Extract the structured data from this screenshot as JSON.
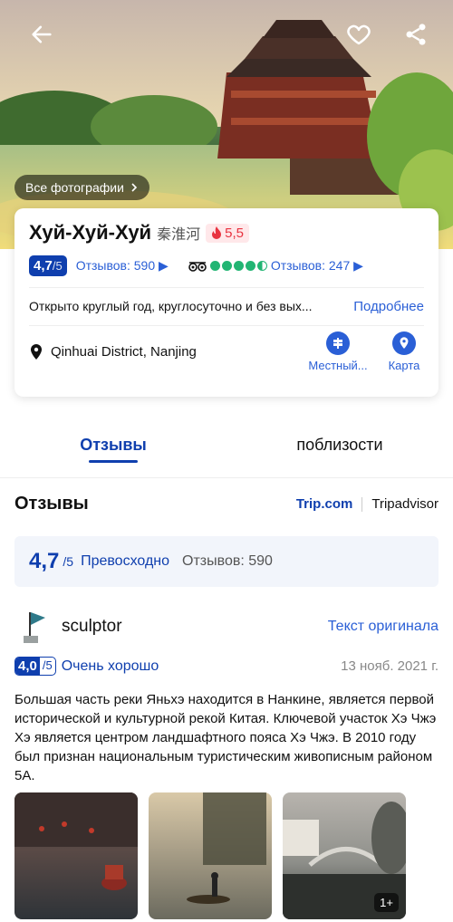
{
  "hero": {
    "all_photos_label": "Все фотографии"
  },
  "attraction": {
    "name": "Хуй-Хуй-Хуй",
    "name_cn": "秦淮河",
    "hot_score": "5,5",
    "trip_score": "4,7",
    "trip_score_max": "/5",
    "trip_reviews": "Отзывов: 590",
    "ta_reviews": "Отзывов: 247",
    "ta_bubbles": 4.5,
    "hours": "Открыто круглый год, круглосуточно и без вых...",
    "more_label": "Подробнее",
    "location": "Qinhuai District, Nanjing",
    "actions": [
      {
        "label": "Местный..."
      },
      {
        "label": "Карта"
      }
    ]
  },
  "tabs": [
    {
      "label": "Отзывы"
    },
    {
      "label": "поблизости"
    }
  ],
  "reviews": {
    "heading": "Отзывы",
    "sources": [
      "Trip.com",
      "Tripadvisor"
    ],
    "summary_score": "4,7",
    "summary_max": "/5",
    "summary_label": "Превосходно",
    "summary_count": "Отзывов: 590",
    "item": {
      "user": "sculptor",
      "original_label": "Текст оригинала",
      "score": "4,0",
      "score_max": "/5",
      "score_label": "Очень хорошо",
      "date": "13 нояб. 2021 г.",
      "text": "Большая часть реки Яньхэ находится в Нанкине, является первой исторической и культурной рекой Китая. Ключевой участок Хэ Чжэ Хэ является центром ландшафтного пояса Хэ Чжэ. В 2010 году был признан национальным туристическим живописным районом 5А.",
      "more_photos": "1+"
    }
  },
  "colors": {
    "brand": "#0f3fae",
    "link": "#2a5fd6",
    "hot": "#e8323f",
    "tripadvisor": "#22b573"
  }
}
